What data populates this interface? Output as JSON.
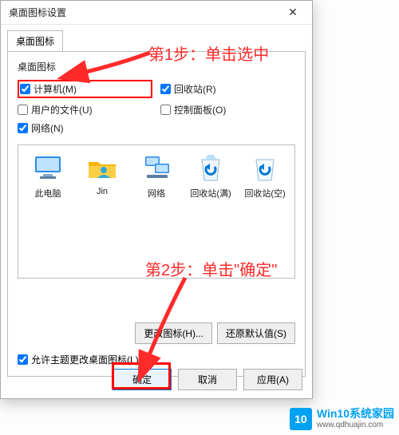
{
  "window": {
    "title": "桌面图标设置",
    "close_glyph": "✕"
  },
  "tab": {
    "label": "桌面图标"
  },
  "group": {
    "title": "桌面图标",
    "checks": {
      "computer": "计算机(M)",
      "recycle": "回收站(R)",
      "userfiles": "用户的文件(U)",
      "control": "控制面板(O)",
      "network": "网络(N)"
    },
    "checked": {
      "computer": true,
      "recycle": true,
      "userfiles": false,
      "control": false,
      "network": true
    }
  },
  "icons": {
    "pc": "此电脑",
    "user": "Jin",
    "network": "网络",
    "bin_full": "回收站(满)",
    "bin_empty": "回收站(空)"
  },
  "buttons": {
    "change": "更改图标(H)...",
    "restore": "还原默认值(S)",
    "ok": "确定",
    "cancel": "取消",
    "apply": "应用(A)"
  },
  "allow_theme": "允许主题更改桌面图标(L)",
  "annot": {
    "step1": "第1步：单击选中",
    "step2": "第2步：单击\"确定\""
  },
  "watermark": {
    "badge": "10",
    "line1": "Win10系统家园",
    "line2": "www.qdhuajin.com"
  }
}
